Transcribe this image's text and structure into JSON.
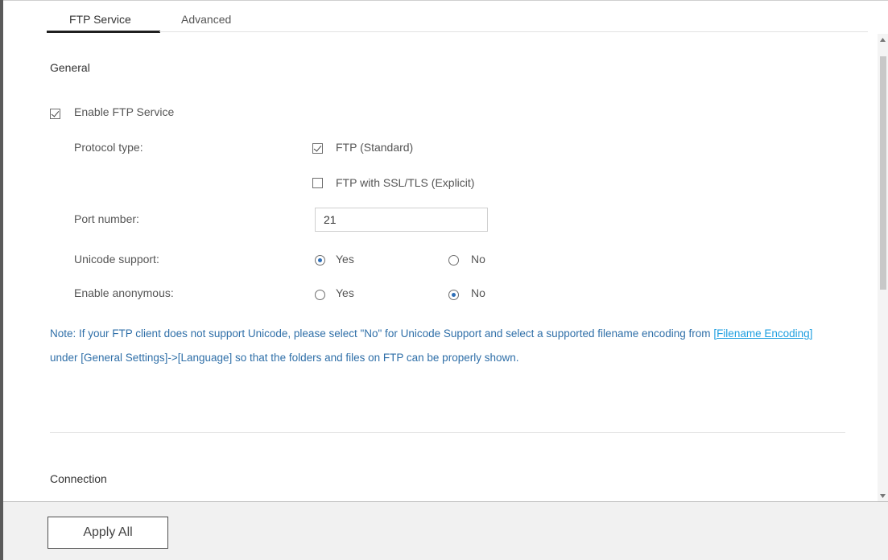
{
  "tabs": [
    {
      "label": "FTP Service",
      "active": true
    },
    {
      "label": "Advanced",
      "active": false
    }
  ],
  "general": {
    "title": "General",
    "enable_ftp": {
      "label": "Enable FTP Service",
      "checked": true
    },
    "protocol": {
      "label": "Protocol type:",
      "options": [
        {
          "label": "FTP (Standard)",
          "checked": true
        },
        {
          "label": "FTP with SSL/TLS (Explicit)",
          "checked": false
        }
      ]
    },
    "port": {
      "label": "Port number:",
      "value": "21"
    },
    "unicode": {
      "label": "Unicode support:",
      "yes": "Yes",
      "no": "No",
      "selected": "Yes"
    },
    "anonymous": {
      "label": "Enable anonymous:",
      "yes": "Yes",
      "no": "No",
      "selected": "No"
    }
  },
  "note": {
    "label": "Note:",
    "text_before_link": " If your FTP client does not support Unicode, please select \"No\" for Unicode Support and select a supported filename encoding from ",
    "link": "[Filename Encoding]",
    "text_after_link": " under [General Settings]->[Language] so that the folders and files on FTP can be properly shown."
  },
  "connection": {
    "title": "Connection"
  },
  "footer": {
    "apply_all_label": "Apply All"
  },
  "colors": {
    "note_text": "#2f6fa8",
    "link": "#1e9fe0",
    "radio_selected": "#2f6fb7"
  }
}
